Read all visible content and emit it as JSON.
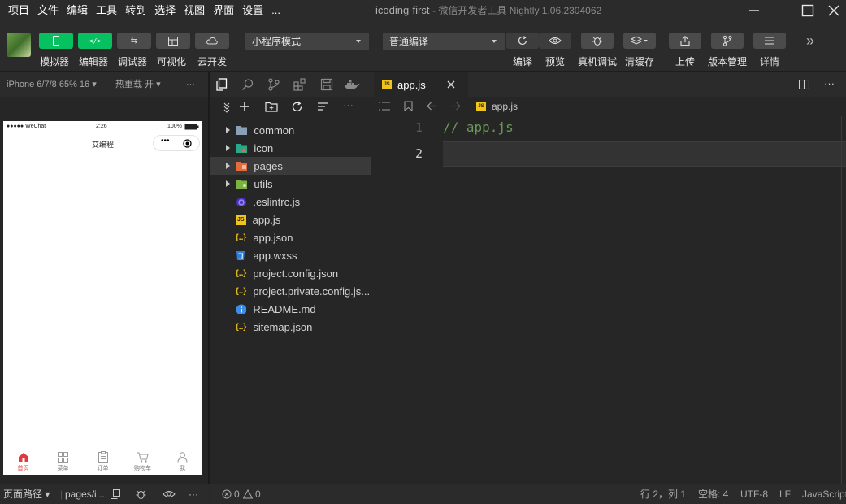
{
  "menu": [
    "项目",
    "文件",
    "编辑",
    "工具",
    "转到",
    "选择",
    "视图",
    "界面",
    "设置",
    "..."
  ],
  "window": {
    "title": "icoding-first",
    "subtitle": "- 微信开发者工具 Nightly 1.06.2304062"
  },
  "toolbar": {
    "left_buttons": [
      {
        "label": "模拟器",
        "icon": "phone-icon"
      },
      {
        "label": "编辑器",
        "icon": "code-icon"
      },
      {
        "label": "调试器",
        "icon": "debug-arrows-icon"
      },
      {
        "label": "可视化",
        "icon": "layout-icon"
      },
      {
        "label": "云开发",
        "icon": "cloud-icon"
      }
    ],
    "mode_select": "小程序模式",
    "compile_select": "普通编译",
    "right_buttons": [
      {
        "label": "编译",
        "icon": "refresh-icon"
      },
      {
        "label": "预览",
        "icon": "eye-icon"
      },
      {
        "label": "真机调试",
        "icon": "bug-icon"
      },
      {
        "label": "清缓存",
        "icon": "layers-icon"
      },
      {
        "label": "上传",
        "icon": "upload-icon"
      },
      {
        "label": "版本管理",
        "icon": "branch-icon"
      },
      {
        "label": "详情",
        "icon": "menu-icon"
      }
    ],
    "more": "»"
  },
  "simulator": {
    "device": "iPhone 6/7/8 65% 16 ▾",
    "hot_reload": "热重载 开 ▾",
    "more": "···",
    "statusbar": {
      "carrier": "●●●●● WeChat",
      "time": "2:26",
      "battery": "100%"
    },
    "nav_title": "艾编程",
    "tabs": [
      {
        "label": "首页",
        "icon": "home-icon",
        "active": true
      },
      {
        "label": "菜单",
        "icon": "grid-icon",
        "active": false
      },
      {
        "label": "订单",
        "icon": "clipboard-icon",
        "active": false
      },
      {
        "label": "购物车",
        "icon": "cart-icon",
        "active": false
      },
      {
        "label": "我",
        "icon": "person-icon",
        "active": false
      }
    ]
  },
  "explorer": {
    "more": "···",
    "tree": [
      {
        "name": "common",
        "type": "folder",
        "color": "#8aa0b8"
      },
      {
        "name": "icon",
        "type": "folder",
        "color": "#2aa88a"
      },
      {
        "name": "pages",
        "type": "folder",
        "color": "#e26c3c",
        "selected": true
      },
      {
        "name": "utils",
        "type": "folder",
        "color": "#7bb241"
      },
      {
        "name": ".eslintrc.js",
        "type": "eslint"
      },
      {
        "name": "app.js",
        "type": "js"
      },
      {
        "name": "app.json",
        "type": "json"
      },
      {
        "name": "app.wxss",
        "type": "css"
      },
      {
        "name": "project.config.json",
        "type": "json"
      },
      {
        "name": "project.private.config.js...",
        "type": "json"
      },
      {
        "name": "README.md",
        "type": "info"
      },
      {
        "name": "sitemap.json",
        "type": "json"
      }
    ]
  },
  "editor": {
    "tab": "app.js",
    "breadcrumb": "app.js",
    "lines": [
      {
        "num": "1",
        "text": "// app.js"
      },
      {
        "num": "2",
        "text": ""
      }
    ]
  },
  "status": {
    "page_path_label": "页面路径 ▾",
    "page_path": "pages/i...",
    "errors": "0",
    "warnings": "0",
    "position": "行 2，列 1",
    "spaces": "空格: 4",
    "encoding": "UTF-8",
    "eol": "LF",
    "language": "JavaScript"
  }
}
